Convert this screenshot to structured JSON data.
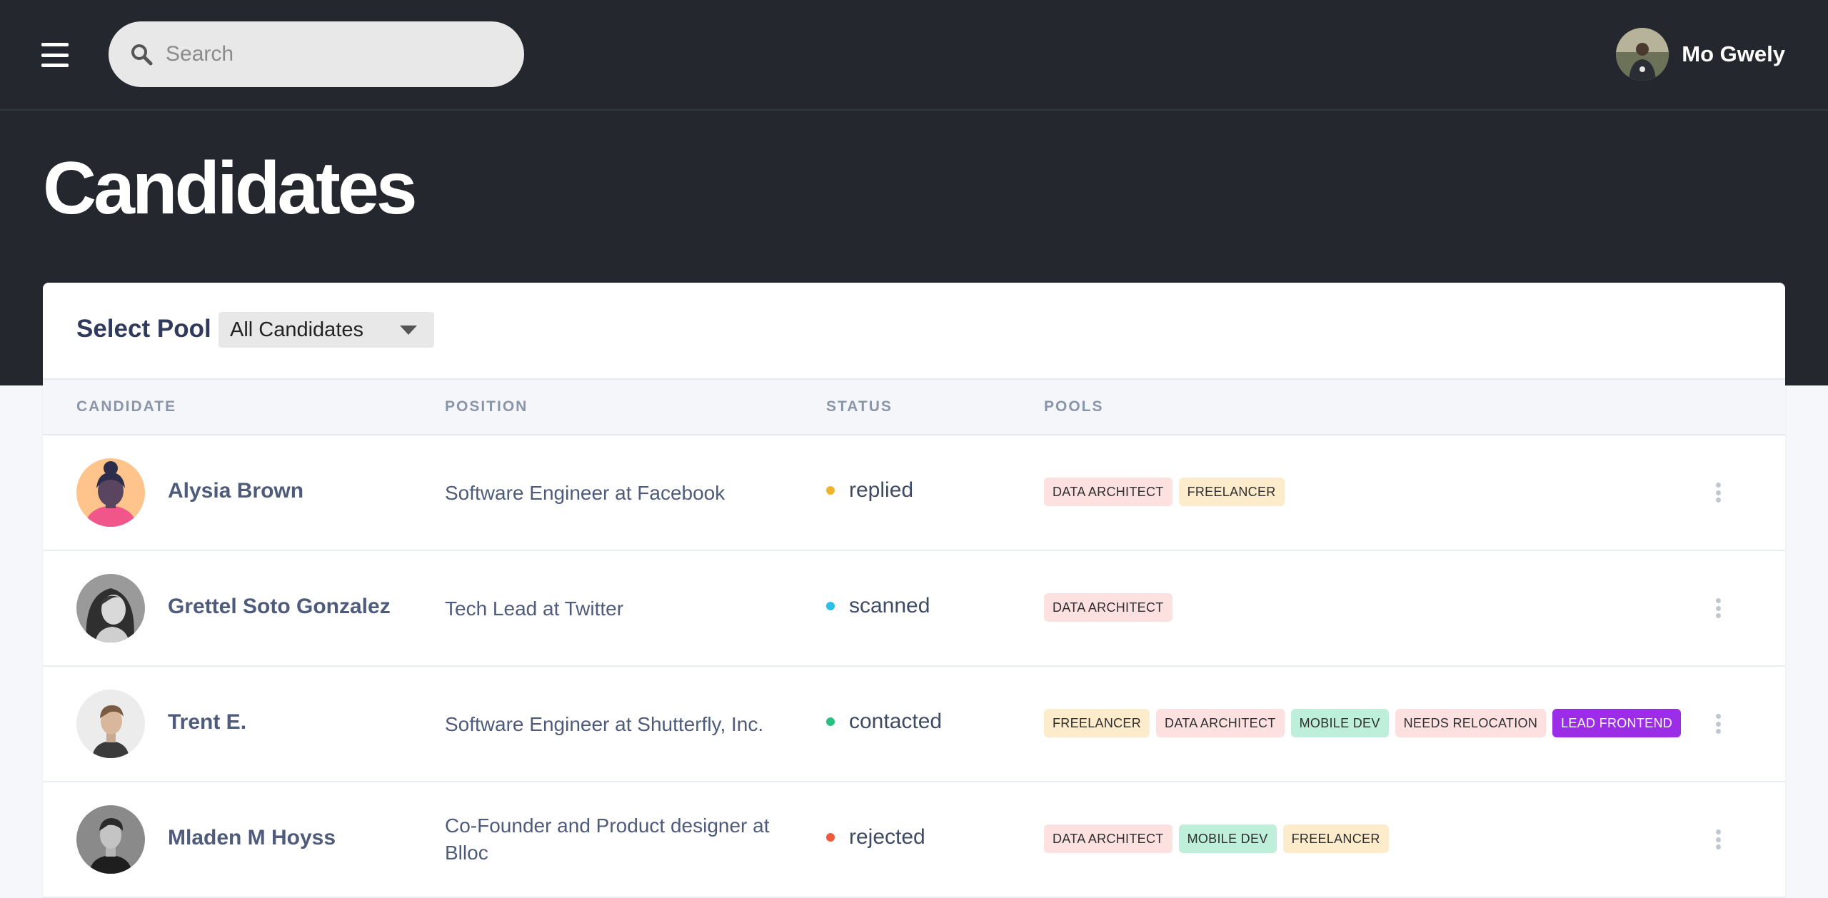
{
  "header": {
    "menu_icon": "hamburger-menu-icon",
    "search": {
      "placeholder": "Search",
      "value": "",
      "icon": "search-icon"
    },
    "user": {
      "name": "Mo Gwely"
    }
  },
  "page": {
    "title": "Candidates"
  },
  "pool": {
    "label": "Select Pool",
    "selected": "All Candidates"
  },
  "table": {
    "columns": {
      "candidate": "CANDIDATE",
      "position": "POSITION",
      "status": "STATUS",
      "pools": "POOLS"
    },
    "rows": [
      {
        "name": "Alysia Brown",
        "position": "Software Engineer at Facebook",
        "status": "replied",
        "tags": [
          "DATA ARCHITECT",
          "FREELANCER"
        ]
      },
      {
        "name": "Grettel Soto Gonzalez",
        "position": "Tech Lead at Twitter",
        "status": "scanned",
        "tags": [
          "DATA ARCHITECT"
        ]
      },
      {
        "name": "Trent E.",
        "position": "Software Engineer at Shutterfly, Inc.",
        "status": "contacted",
        "tags": [
          "FREELANCER",
          "DATA ARCHITECT",
          "MOBILE DEV",
          "NEEDS RELOCATION",
          "LEAD FRONTEND"
        ]
      },
      {
        "name": "Mladen M Hoyss",
        "position": "Co-Founder and Product designer at Blloc",
        "status": "rejected",
        "tags": [
          "DATA ARCHITECT",
          "MOBILE DEV",
          "FREELANCER"
        ]
      }
    ]
  },
  "colors": {
    "header_bg": "#24272d",
    "status": {
      "replied": "#f0b429",
      "scanned": "#2bc0e4",
      "contacted": "#27c281",
      "rejected": "#ef5a3c"
    },
    "tags": {
      "DATA ARCHITECT": "#fde1e1",
      "FREELANCER": "#fdeccb",
      "MOBILE DEV": "#bdefda",
      "NEEDS RELOCATION": "#fde1e1",
      "LEAD FRONTEND": "#9b2de6"
    }
  }
}
